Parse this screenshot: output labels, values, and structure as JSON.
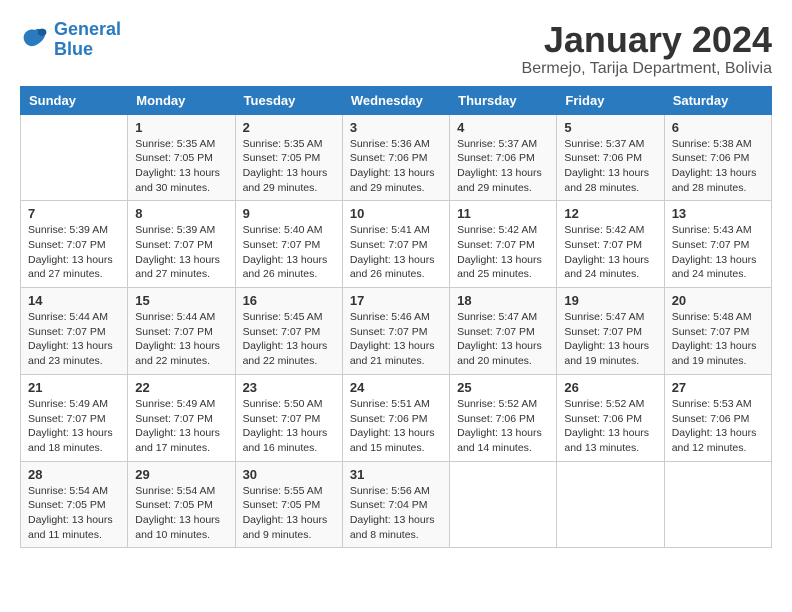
{
  "logo": {
    "text_general": "General",
    "text_blue": "Blue"
  },
  "title": "January 2024",
  "subtitle": "Bermejo, Tarija Department, Bolivia",
  "weekdays": [
    "Sunday",
    "Monday",
    "Tuesday",
    "Wednesday",
    "Thursday",
    "Friday",
    "Saturday"
  ],
  "weeks": [
    [
      null,
      {
        "day": 1,
        "sunrise": "5:35 AM",
        "sunset": "7:05 PM",
        "daylight": "13 hours and 30 minutes."
      },
      {
        "day": 2,
        "sunrise": "5:35 AM",
        "sunset": "7:05 PM",
        "daylight": "13 hours and 29 minutes."
      },
      {
        "day": 3,
        "sunrise": "5:36 AM",
        "sunset": "7:06 PM",
        "daylight": "13 hours and 29 minutes."
      },
      {
        "day": 4,
        "sunrise": "5:37 AM",
        "sunset": "7:06 PM",
        "daylight": "13 hours and 29 minutes."
      },
      {
        "day": 5,
        "sunrise": "5:37 AM",
        "sunset": "7:06 PM",
        "daylight": "13 hours and 28 minutes."
      },
      {
        "day": 6,
        "sunrise": "5:38 AM",
        "sunset": "7:06 PM",
        "daylight": "13 hours and 28 minutes."
      }
    ],
    [
      {
        "day": 7,
        "sunrise": "5:39 AM",
        "sunset": "7:07 PM",
        "daylight": "13 hours and 27 minutes."
      },
      {
        "day": 8,
        "sunrise": "5:39 AM",
        "sunset": "7:07 PM",
        "daylight": "13 hours and 27 minutes."
      },
      {
        "day": 9,
        "sunrise": "5:40 AM",
        "sunset": "7:07 PM",
        "daylight": "13 hours and 26 minutes."
      },
      {
        "day": 10,
        "sunrise": "5:41 AM",
        "sunset": "7:07 PM",
        "daylight": "13 hours and 26 minutes."
      },
      {
        "day": 11,
        "sunrise": "5:42 AM",
        "sunset": "7:07 PM",
        "daylight": "13 hours and 25 minutes."
      },
      {
        "day": 12,
        "sunrise": "5:42 AM",
        "sunset": "7:07 PM",
        "daylight": "13 hours and 24 minutes."
      },
      {
        "day": 13,
        "sunrise": "5:43 AM",
        "sunset": "7:07 PM",
        "daylight": "13 hours and 24 minutes."
      }
    ],
    [
      {
        "day": 14,
        "sunrise": "5:44 AM",
        "sunset": "7:07 PM",
        "daylight": "13 hours and 23 minutes."
      },
      {
        "day": 15,
        "sunrise": "5:44 AM",
        "sunset": "7:07 PM",
        "daylight": "13 hours and 22 minutes."
      },
      {
        "day": 16,
        "sunrise": "5:45 AM",
        "sunset": "7:07 PM",
        "daylight": "13 hours and 22 minutes."
      },
      {
        "day": 17,
        "sunrise": "5:46 AM",
        "sunset": "7:07 PM",
        "daylight": "13 hours and 21 minutes."
      },
      {
        "day": 18,
        "sunrise": "5:47 AM",
        "sunset": "7:07 PM",
        "daylight": "13 hours and 20 minutes."
      },
      {
        "day": 19,
        "sunrise": "5:47 AM",
        "sunset": "7:07 PM",
        "daylight": "13 hours and 19 minutes."
      },
      {
        "day": 20,
        "sunrise": "5:48 AM",
        "sunset": "7:07 PM",
        "daylight": "13 hours and 19 minutes."
      }
    ],
    [
      {
        "day": 21,
        "sunrise": "5:49 AM",
        "sunset": "7:07 PM",
        "daylight": "13 hours and 18 minutes."
      },
      {
        "day": 22,
        "sunrise": "5:49 AM",
        "sunset": "7:07 PM",
        "daylight": "13 hours and 17 minutes."
      },
      {
        "day": 23,
        "sunrise": "5:50 AM",
        "sunset": "7:07 PM",
        "daylight": "13 hours and 16 minutes."
      },
      {
        "day": 24,
        "sunrise": "5:51 AM",
        "sunset": "7:06 PM",
        "daylight": "13 hours and 15 minutes."
      },
      {
        "day": 25,
        "sunrise": "5:52 AM",
        "sunset": "7:06 PM",
        "daylight": "13 hours and 14 minutes."
      },
      {
        "day": 26,
        "sunrise": "5:52 AM",
        "sunset": "7:06 PM",
        "daylight": "13 hours and 13 minutes."
      },
      {
        "day": 27,
        "sunrise": "5:53 AM",
        "sunset": "7:06 PM",
        "daylight": "13 hours and 12 minutes."
      }
    ],
    [
      {
        "day": 28,
        "sunrise": "5:54 AM",
        "sunset": "7:05 PM",
        "daylight": "13 hours and 11 minutes."
      },
      {
        "day": 29,
        "sunrise": "5:54 AM",
        "sunset": "7:05 PM",
        "daylight": "13 hours and 10 minutes."
      },
      {
        "day": 30,
        "sunrise": "5:55 AM",
        "sunset": "7:05 PM",
        "daylight": "13 hours and 9 minutes."
      },
      {
        "day": 31,
        "sunrise": "5:56 AM",
        "sunset": "7:04 PM",
        "daylight": "13 hours and 8 minutes."
      },
      null,
      null,
      null
    ]
  ]
}
